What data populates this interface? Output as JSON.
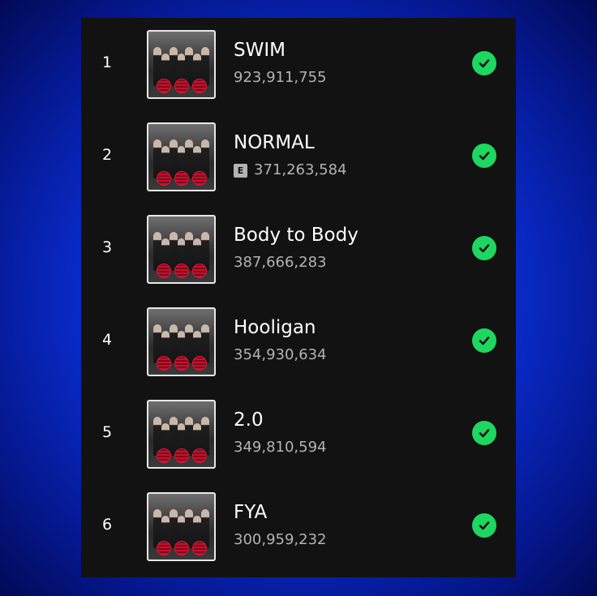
{
  "tracks": [
    {
      "number": "1",
      "title": "SWIM",
      "plays": "923,911,755",
      "explicit": false,
      "saved": true
    },
    {
      "number": "2",
      "title": "NORMAL",
      "plays": "371,263,584",
      "explicit": true,
      "explicit_label": "E",
      "saved": true
    },
    {
      "number": "3",
      "title": "Body to Body",
      "plays": "387,666,283",
      "explicit": false,
      "saved": true
    },
    {
      "number": "4",
      "title": "Hooligan",
      "plays": "354,930,634",
      "explicit": false,
      "saved": true
    },
    {
      "number": "5",
      "title": "2.0",
      "plays": "349,810,594",
      "explicit": false,
      "saved": true
    },
    {
      "number": "6",
      "title": "FYA",
      "plays": "300,959,232",
      "explicit": false,
      "saved": true
    }
  ],
  "icons": {
    "saved": "check-circle-icon",
    "explicit": "explicit-badge"
  },
  "colors": {
    "background_blue": "#0a2fd6",
    "panel": "#121212",
    "accent_green": "#1ed760",
    "secondary_text": "#b3b3b3"
  }
}
